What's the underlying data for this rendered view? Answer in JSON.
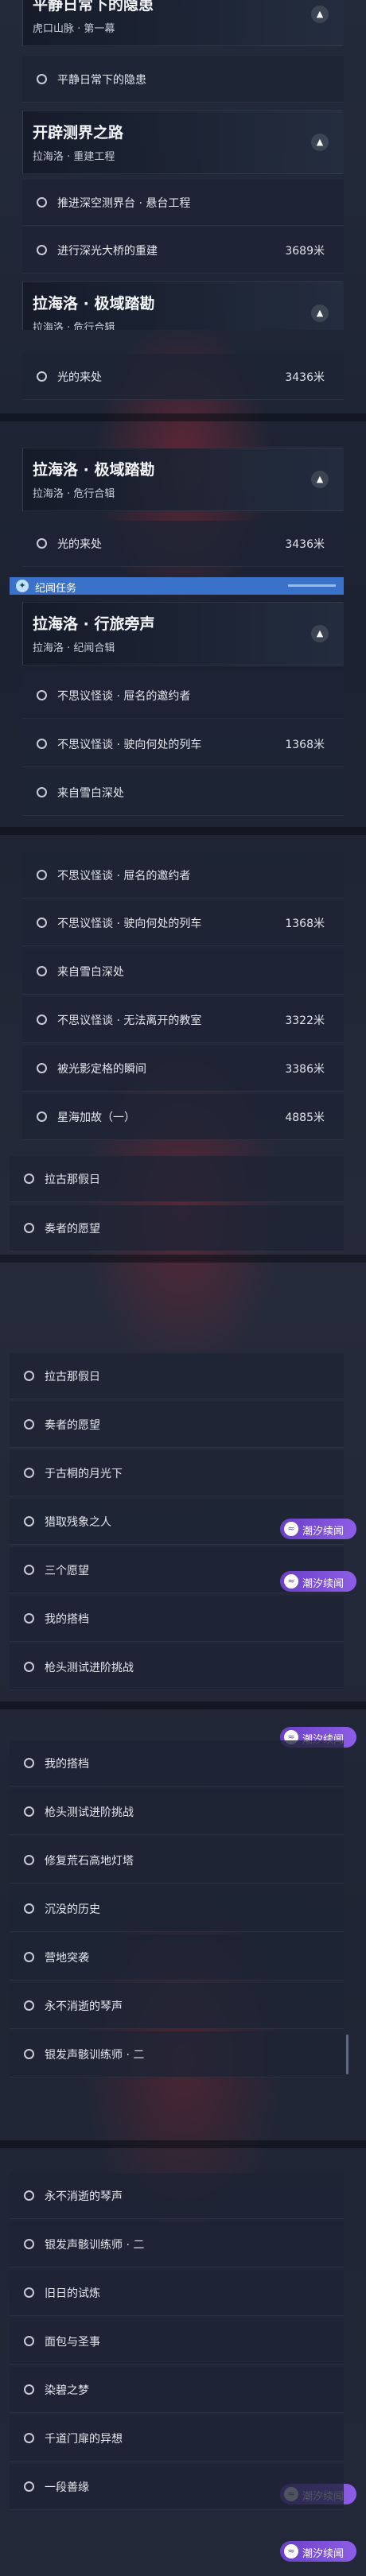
{
  "frames": [
    {
      "cards": [
        {
          "title": "平静日常下的隐患",
          "sub": "虎口山脉 · 第一幕"
        },
        {
          "title": "开辟测界之路",
          "sub": "拉海洛 · 重建工程"
        },
        {
          "title": "拉海洛 · 极域踏勘",
          "sub": "拉海洛 · 危行合辑"
        }
      ],
      "rows": [
        {
          "label": "平静日常下的隐患",
          "dist": ""
        },
        {
          "label": "推进深空测界台 · 悬台工程",
          "dist": ""
        },
        {
          "label": "进行深光大桥的重建",
          "dist": "3689米"
        },
        {
          "label": "光的来处",
          "dist": "3436米"
        }
      ]
    },
    {
      "cards": [
        {
          "title": "拉海洛 · 极域踏勘",
          "sub": "拉海洛 · 危行合辑"
        },
        {
          "title": "拉海洛 · 行旅旁声",
          "sub": "拉海洛 · 纪闻合辑"
        }
      ],
      "section": "纪闻任务",
      "rows": [
        {
          "label": "光的来处",
          "dist": "3436米"
        },
        {
          "label": "不思议怪谈 · 屉名的邀约者",
          "dist": ""
        },
        {
          "label": "不思议怪谈 · 驶向何处的列车",
          "dist": "1368米"
        },
        {
          "label": "来自雪白深处",
          "dist": ""
        }
      ]
    },
    {
      "rows": [
        {
          "label": "不思议怪谈 · 屉名的邀约者",
          "dist": ""
        },
        {
          "label": "不思议怪谈 · 驶向何处的列车",
          "dist": "1368米"
        },
        {
          "label": "来自雪白深处",
          "dist": ""
        },
        {
          "label": "不思议怪谈 · 无法离开的教室",
          "dist": "3322米"
        },
        {
          "label": "被光影定格的瞬间",
          "dist": "3386米"
        },
        {
          "label": "星海加故（一）",
          "dist": "4885米"
        },
        {
          "label": "拉古那假日",
          "dist": ""
        },
        {
          "label": "奏者的愿望",
          "dist": ""
        }
      ]
    },
    {
      "tag": "潮汐续闻",
      "rows": [
        {
          "label": "拉古那假日"
        },
        {
          "label": "奏者的愿望"
        },
        {
          "label": "于古桐的月光下"
        },
        {
          "label": "猎取残象之人"
        },
        {
          "label": "三个愿望"
        },
        {
          "label": "我的搭档"
        },
        {
          "label": "枪头测试进阶挑战"
        }
      ]
    },
    {
      "tag": "潮汐续闻",
      "rows": [
        {
          "label": "我的搭档"
        },
        {
          "label": "枪头测试进阶挑战"
        },
        {
          "label": "修复荒石高地灯塔"
        },
        {
          "label": "沉没的历史"
        },
        {
          "label": "营地突袭"
        },
        {
          "label": "永不消逝的琴声"
        },
        {
          "label": "银发声骸训练师 · 二"
        }
      ]
    },
    {
      "tag": "潮汐续闻",
      "rows": [
        {
          "label": "永不消逝的琴声"
        },
        {
          "label": "银发声骸训练师 · 二"
        },
        {
          "label": "旧日的试炼"
        },
        {
          "label": "面包与圣事"
        },
        {
          "label": "染碧之梦"
        },
        {
          "label": "千道门扉的异想"
        },
        {
          "label": "一段善缘"
        }
      ]
    }
  ]
}
